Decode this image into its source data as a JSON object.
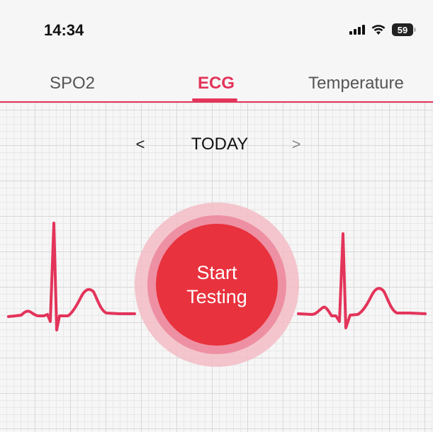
{
  "status_bar": {
    "time": "14:34",
    "battery": "59"
  },
  "tabs": [
    {
      "label": "SPO2",
      "active": false
    },
    {
      "label": "ECG",
      "active": true
    },
    {
      "label": "Temperature",
      "active": false
    }
  ],
  "date_nav": {
    "prev": "<",
    "label": "TODAY",
    "next": ">"
  },
  "start_button": {
    "line1": "Start",
    "line2": "Testing"
  },
  "colors": {
    "accent": "#e3345a",
    "button": "#e8323d",
    "grid": "#d8d8d8",
    "background": "#f6f6f6"
  },
  "icons": [
    "signal-icon",
    "wifi-icon",
    "battery-icon"
  ]
}
